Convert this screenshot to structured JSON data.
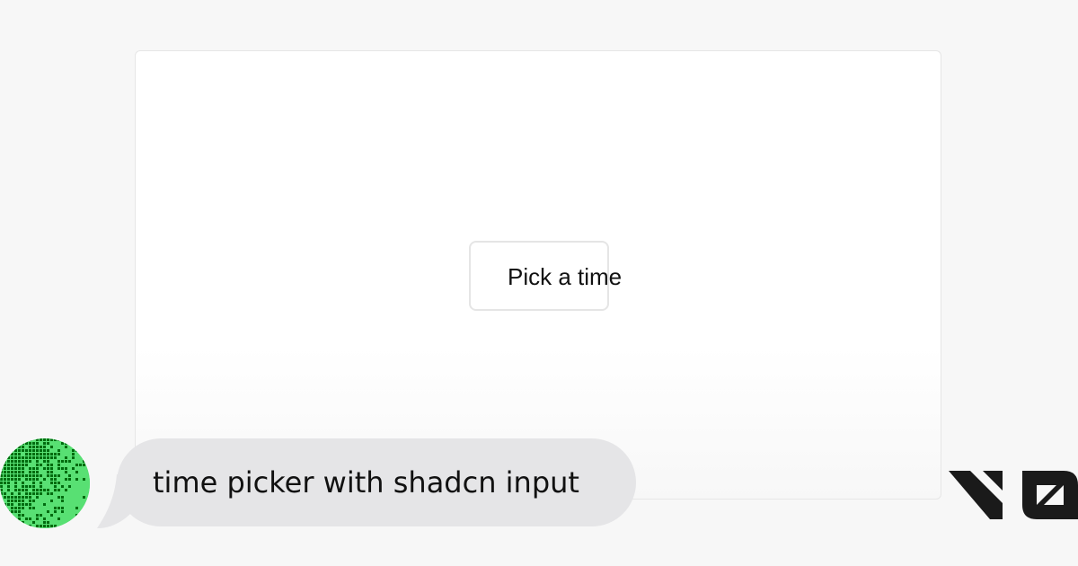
{
  "preview": {
    "button_label": "Pick a time"
  },
  "prompt": {
    "text": "time picker with shadcn input"
  },
  "logo": {
    "text": "v0"
  },
  "colors": {
    "background": "#f7f7f7",
    "card": "#ffffff",
    "bubble": "#e5e5e7",
    "avatar_light": "#58e073",
    "avatar_dark": "#006b0f",
    "logo": "#1a1a1a"
  },
  "icons": {
    "avatar": "pixel-gradient-avatar",
    "logo": "v0-logo"
  }
}
